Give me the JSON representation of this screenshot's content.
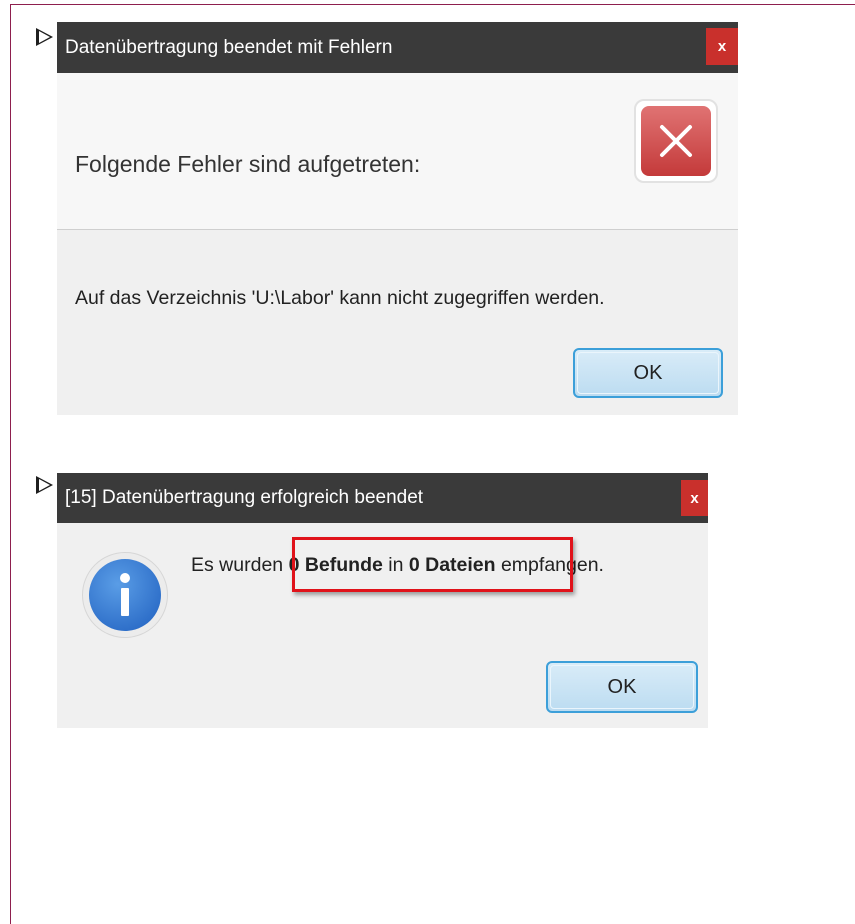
{
  "dialog_error": {
    "title": "Datenübertragung beendet mit Fehlern",
    "close_label": "x",
    "header": "Folgende Fehler sind aufgetreten:",
    "message": "Auf das Verzeichnis 'U:\\Labor' kann nicht zugegriffen werden.",
    "ok_label": "OK",
    "icon": "error-x-icon"
  },
  "dialog_success": {
    "title": "[15] Datenübertragung erfolgreich beendet",
    "close_label": "x",
    "message_prefix": "Es wurden ",
    "count_findings": "0 Befunde",
    "message_mid": " in ",
    "count_files": "0 Dateien",
    "message_suffix": " empfangen.",
    "ok_label": "OK",
    "icon": "info-icon"
  },
  "colors": {
    "title_bar": "#3a3a3a",
    "close_button": "#c9302c",
    "frame_border": "#8e1f4e",
    "highlight_box": "#e0121a",
    "ok_border": "#3c9fd9"
  }
}
